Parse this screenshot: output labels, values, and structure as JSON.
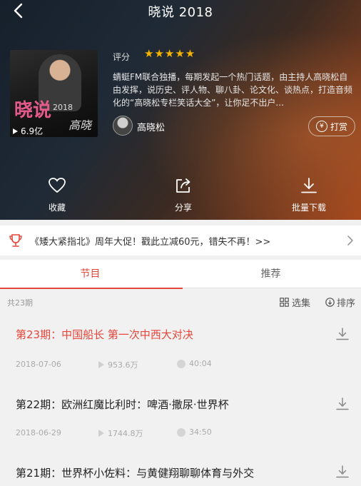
{
  "header": {
    "title": "晓说 2018"
  },
  "album": {
    "cover": {
      "logo_text": "晓说",
      "logo_sub": "2018",
      "signature": "高晓"
    },
    "play_count": "6.9亿",
    "rating_label": "评分",
    "stars": "★★★★★",
    "description": "蜻蜓FM联合独播，每期发起一个热门话题，由主持人高晓松自由发挥，说历史、评人物、聊八卦、论文化、谈热点，打造音频化的“高晓松专栏笑话大全”，让你足不出户...",
    "host_name": "高晓松",
    "reward_label": "打赏",
    "reward_icon": "¥"
  },
  "actions": [
    {
      "label": "收藏",
      "icon": "heart-icon"
    },
    {
      "label": "分享",
      "icon": "share-icon"
    },
    {
      "label": "批量下载",
      "icon": "download-icon"
    }
  ],
  "promo": {
    "text": "《矮大紧指北》周年大促！戳此立减60元，错失不再！>>"
  },
  "tabs": [
    {
      "label": "节目",
      "active": true
    },
    {
      "label": "推荐",
      "active": false
    }
  ],
  "list": {
    "count": "共23期",
    "select_label": "选集",
    "sort_label": "排序"
  },
  "episodes": [
    {
      "title": "第23期：中国船长 第一次中西大对决",
      "date": "2018-07-06",
      "plays": "953.6万",
      "duration": "40:04",
      "current": true
    },
    {
      "title": "第22期：欧洲红魔比利时：啤酒·撒尿·世界杯",
      "date": "2018-06-29",
      "plays": "1744.8万",
      "duration": "34:50",
      "current": false
    },
    {
      "title": "第21期：世界杯小佐料：与黄健翔聊聊体育与外交",
      "date": "",
      "plays": "",
      "duration": "",
      "current": false
    }
  ],
  "colors": {
    "accent": "#e6453a",
    "star": "#f5b400"
  }
}
